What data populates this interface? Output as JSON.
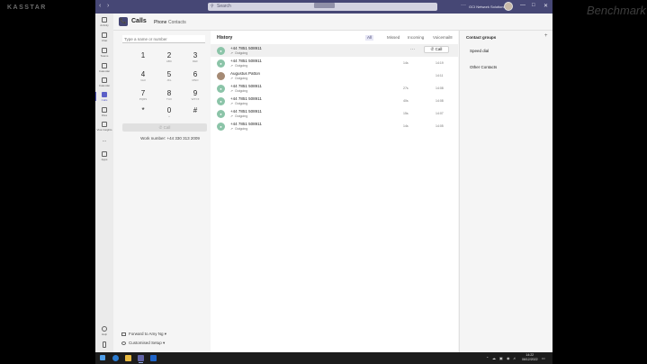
{
  "watermarks": {
    "left": "KASSTAR",
    "right": "Benchmark"
  },
  "titlebar": {
    "back": "‹",
    "forward": "›",
    "search_placeholder": "Search",
    "more": "···",
    "org_name": "GCI Network Solutions",
    "minimize": "—",
    "maximize": "□",
    "close": "✕"
  },
  "rail": [
    {
      "label": "Activity",
      "icon": "bell-icon"
    },
    {
      "label": "Chat",
      "icon": "chat-icon"
    },
    {
      "label": "Teams",
      "icon": "teams-icon"
    },
    {
      "label": "Calendar",
      "icon": "calendar-icon"
    },
    {
      "label": "Calls",
      "icon": "phone-icon",
      "active": true
    },
    {
      "label": "Files",
      "icon": "file-icon"
    },
    {
      "label": "Viva Insights",
      "icon": "insights-icon"
    },
    {
      "label": "...",
      "icon": "more-icon"
    },
    {
      "label": "Apps",
      "icon": "apps-icon"
    },
    {
      "label": "Help",
      "icon": "help-icon"
    },
    {
      "label": "",
      "icon": "device-icon"
    }
  ],
  "header": {
    "icon": "📞",
    "title": "Calls",
    "tabs": [
      {
        "label": "Phone",
        "active": true
      },
      {
        "label": "Contacts",
        "active": false
      }
    ]
  },
  "dialpad": {
    "placeholder": "Type a name or number",
    "keys": [
      {
        "digit": "1",
        "letters": ""
      },
      {
        "digit": "2",
        "letters": "ABC"
      },
      {
        "digit": "3",
        "letters": "DEF"
      },
      {
        "digit": "4",
        "letters": "GHI"
      },
      {
        "digit": "5",
        "letters": "JKL"
      },
      {
        "digit": "6",
        "letters": "MNO"
      },
      {
        "digit": "7",
        "letters": "PQRS"
      },
      {
        "digit": "8",
        "letters": "TUV"
      },
      {
        "digit": "9",
        "letters": "WXYZ"
      },
      {
        "digit": "*",
        "letters": ""
      },
      {
        "digit": "0",
        "letters": "+"
      },
      {
        "digit": "#",
        "letters": ""
      }
    ],
    "call_button": "Call",
    "work_number": "Work number: +44 330 313 2009",
    "forward_label": "Forward to Amy Ng",
    "setup_label": "Customised Setup"
  },
  "history": {
    "title": "History",
    "filters": [
      {
        "label": "All",
        "active": true
      },
      {
        "label": "Missed",
        "active": false
      },
      {
        "label": "Incoming",
        "active": false
      },
      {
        "label": "Voicemail",
        "active": false
      }
    ],
    "call_button": "Call",
    "more": "···",
    "rows": [
      {
        "name": "+44 7851 508911",
        "type": "Outgoing",
        "duration": "",
        "time": "",
        "hover": true,
        "photo": false
      },
      {
        "name": "+44 7851 508911",
        "type": "Outgoing",
        "duration": "14s",
        "time": "14:19",
        "hover": false,
        "photo": false
      },
      {
        "name": "Augustus Patton",
        "type": "Outgoing",
        "duration": "",
        "time": "14:11",
        "hover": false,
        "photo": true
      },
      {
        "name": "+44 7851 508911",
        "type": "Outgoing",
        "duration": "27s",
        "time": "14:08",
        "hover": false,
        "photo": false
      },
      {
        "name": "+44 7851 508911",
        "type": "Outgoing",
        "duration": "40s",
        "time": "14:08",
        "hover": false,
        "photo": false
      },
      {
        "name": "+44 7851 508911",
        "type": "Outgoing",
        "duration": "15s",
        "time": "14:07",
        "hover": false,
        "photo": false
      },
      {
        "name": "+44 7851 508911",
        "type": "Outgoing",
        "duration": "14s",
        "time": "14:05",
        "hover": false,
        "photo": false
      }
    ]
  },
  "groups": {
    "title": "Contact groups",
    "add": "+",
    "items": [
      "Speed dial",
      "Other Contacts"
    ]
  },
  "taskbar": {
    "time": "14:22",
    "date": "06/12/2022"
  },
  "colors": {
    "teams_purple": "#464775",
    "accent": "#5b5fc7",
    "avatar_green": "#8bc4a8"
  }
}
